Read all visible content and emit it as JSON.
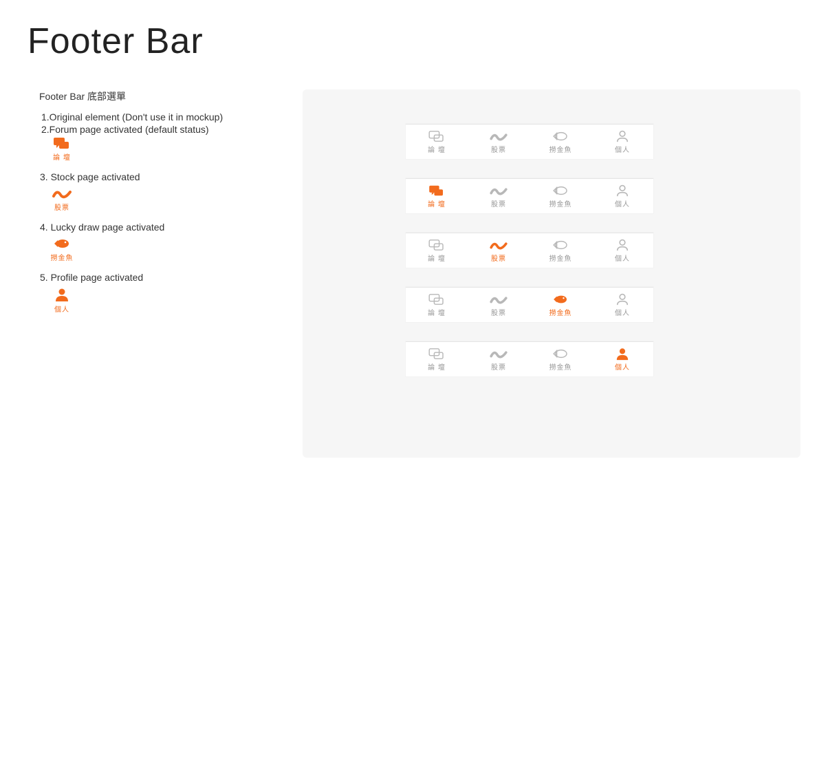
{
  "title": "Footer Bar",
  "subtitle": "Footer Bar 底部選單",
  "notes": {
    "n1": "1.Original element (Don't use it in mockup)",
    "n2": "2.Forum page activated (default status)",
    "n3": "3. Stock page activated",
    "n4": "4. Lucky draw page activated",
    "n5": "5. Profile page activated"
  },
  "labels": {
    "forum": "論 壇",
    "stock": "股票",
    "lucky": "撈金魚",
    "profile": "個人"
  },
  "colors": {
    "active": "#F26B1D",
    "inactive_icon": "#B8B8B8",
    "inactive_text": "#9A9A9A",
    "panel_bg": "#F6F6F6"
  }
}
